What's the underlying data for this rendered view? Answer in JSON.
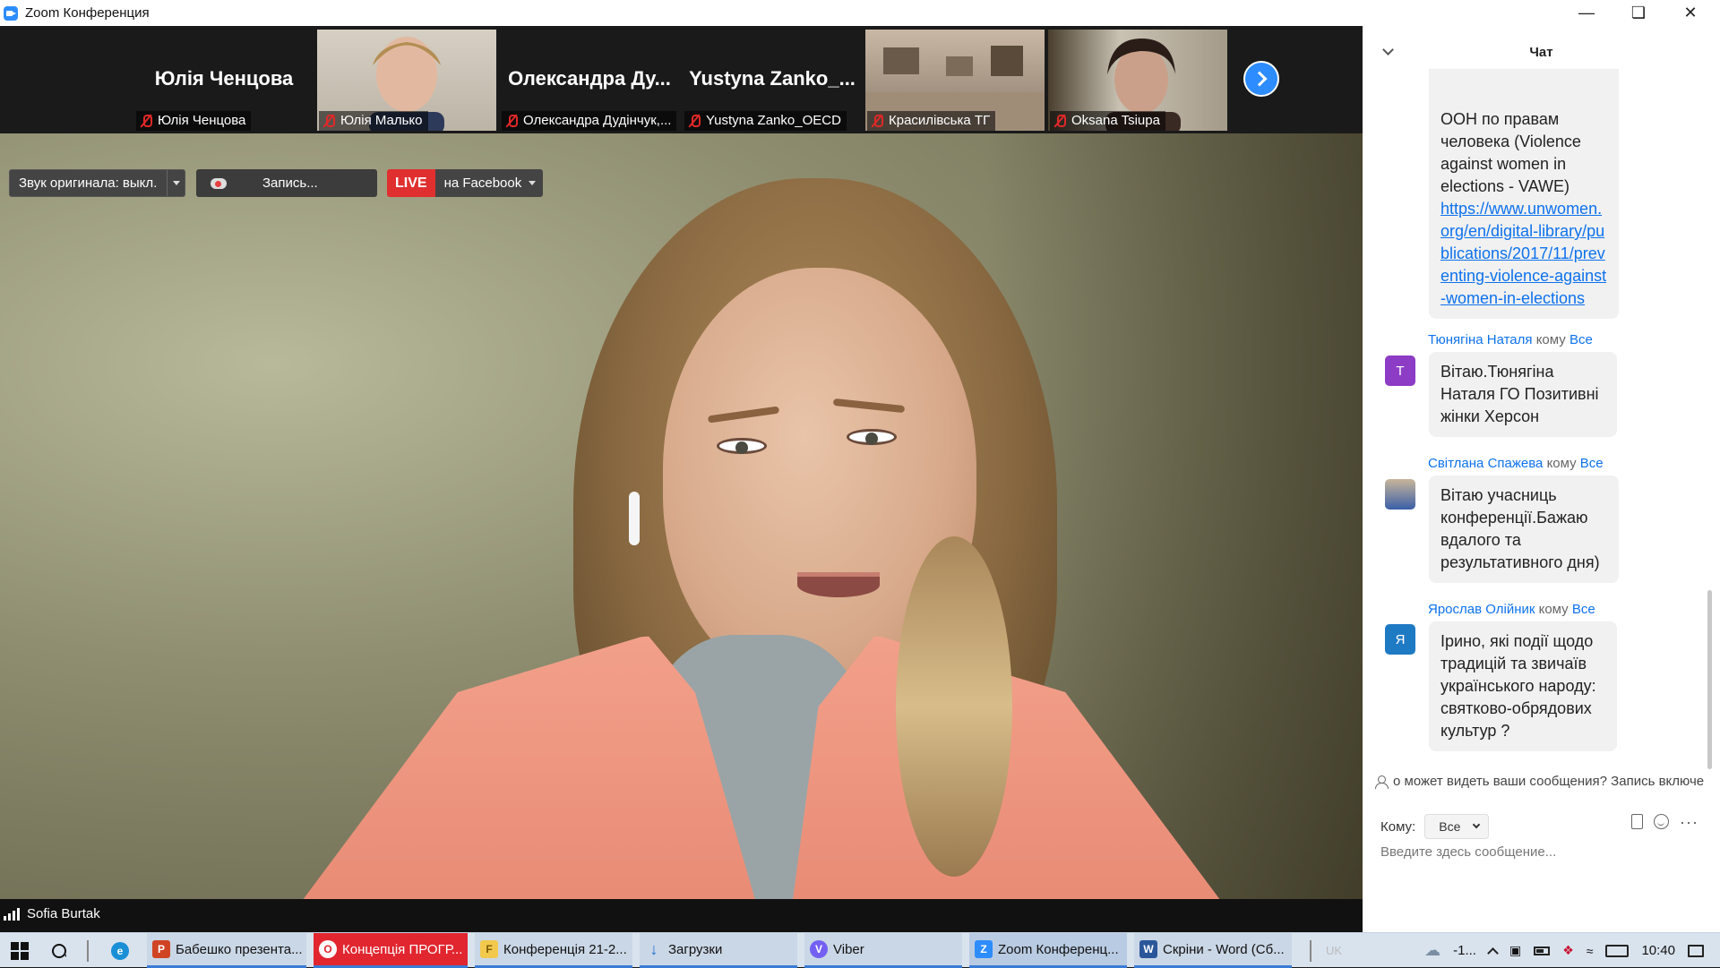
{
  "window": {
    "title": "Zoom Конференция"
  },
  "thumbnails": [
    {
      "big_name": "Юлія Ченцова",
      "label": "Юлія Ченцова",
      "video": false
    },
    {
      "big_name": "",
      "label": "Юлія Малько",
      "video": true
    },
    {
      "big_name": "Олександра Ду...",
      "label": "Олександра Дудінчук,...",
      "video": false
    },
    {
      "big_name": "Yustyna Zanko_...",
      "label": "Yustyna Zanko_OECD",
      "video": false
    },
    {
      "big_name": "",
      "label": "Красилівська ТГ",
      "video": true
    },
    {
      "big_name": "",
      "label": "Oksana Tsiupa",
      "video": true
    }
  ],
  "controls": {
    "original_sound": "Звук оригинала: выкл.",
    "record": "Запись...",
    "live": "LIVE",
    "live_target": "на Facebook"
  },
  "speaker": {
    "name": "Sofia Burtak"
  },
  "chat": {
    "title": "Чат",
    "messages": [
      {
        "sender": "",
        "to_word": "",
        "to": "",
        "avatar": "",
        "text": "ООН по правам человека (Violence against women in elections - VAWE)",
        "link": "https://www.unwomen.org/en/digital-library/publications/2017/11/preventing-violence-against-women-in-elections"
      },
      {
        "sender": "Тюнягіна Наталя",
        "to_word": "кому",
        "to": "Все",
        "avatar": "Т",
        "text": "Вітаю.Тюнягіна Наталя ГО Позитивні жінки Херсон",
        "link": ""
      },
      {
        "sender": "Світлана Спажева",
        "to_word": "кому",
        "to": "Все",
        "avatar": "",
        "text": "Вітаю учасниць конференції.Бажаю вдалого та результативного дня)",
        "link": ""
      },
      {
        "sender": "Ярослав Олійник",
        "to_word": "кому",
        "to": "Все",
        "avatar": "Я",
        "text": "Ірино, які події щодо традицій та звичаїв українського народу: святково-обрядових культур ?",
        "link": ""
      }
    ],
    "visibility_note": "о может видеть ваши сообщения? Запись включе",
    "to_label": "Кому:",
    "to_value": "Все",
    "input_placeholder": "Введите здесь сообщение..."
  },
  "taskbar": {
    "items": [
      {
        "label": "Бабешко презента...",
        "icon": "P"
      },
      {
        "label": "Концепція ПРОГР...",
        "icon": "O"
      },
      {
        "label": "Конференція 21-2...",
        "icon": "F"
      },
      {
        "label": "Загрузки",
        "icon": "↓"
      },
      {
        "label": "Viber",
        "icon": "V"
      },
      {
        "label": "Zoom Конференц...",
        "icon": "Z"
      },
      {
        "label": "Скріни - Word (Сб...",
        "icon": "W"
      }
    ],
    "lang": "UK",
    "temp": "-1...",
    "clock": "10:40"
  }
}
